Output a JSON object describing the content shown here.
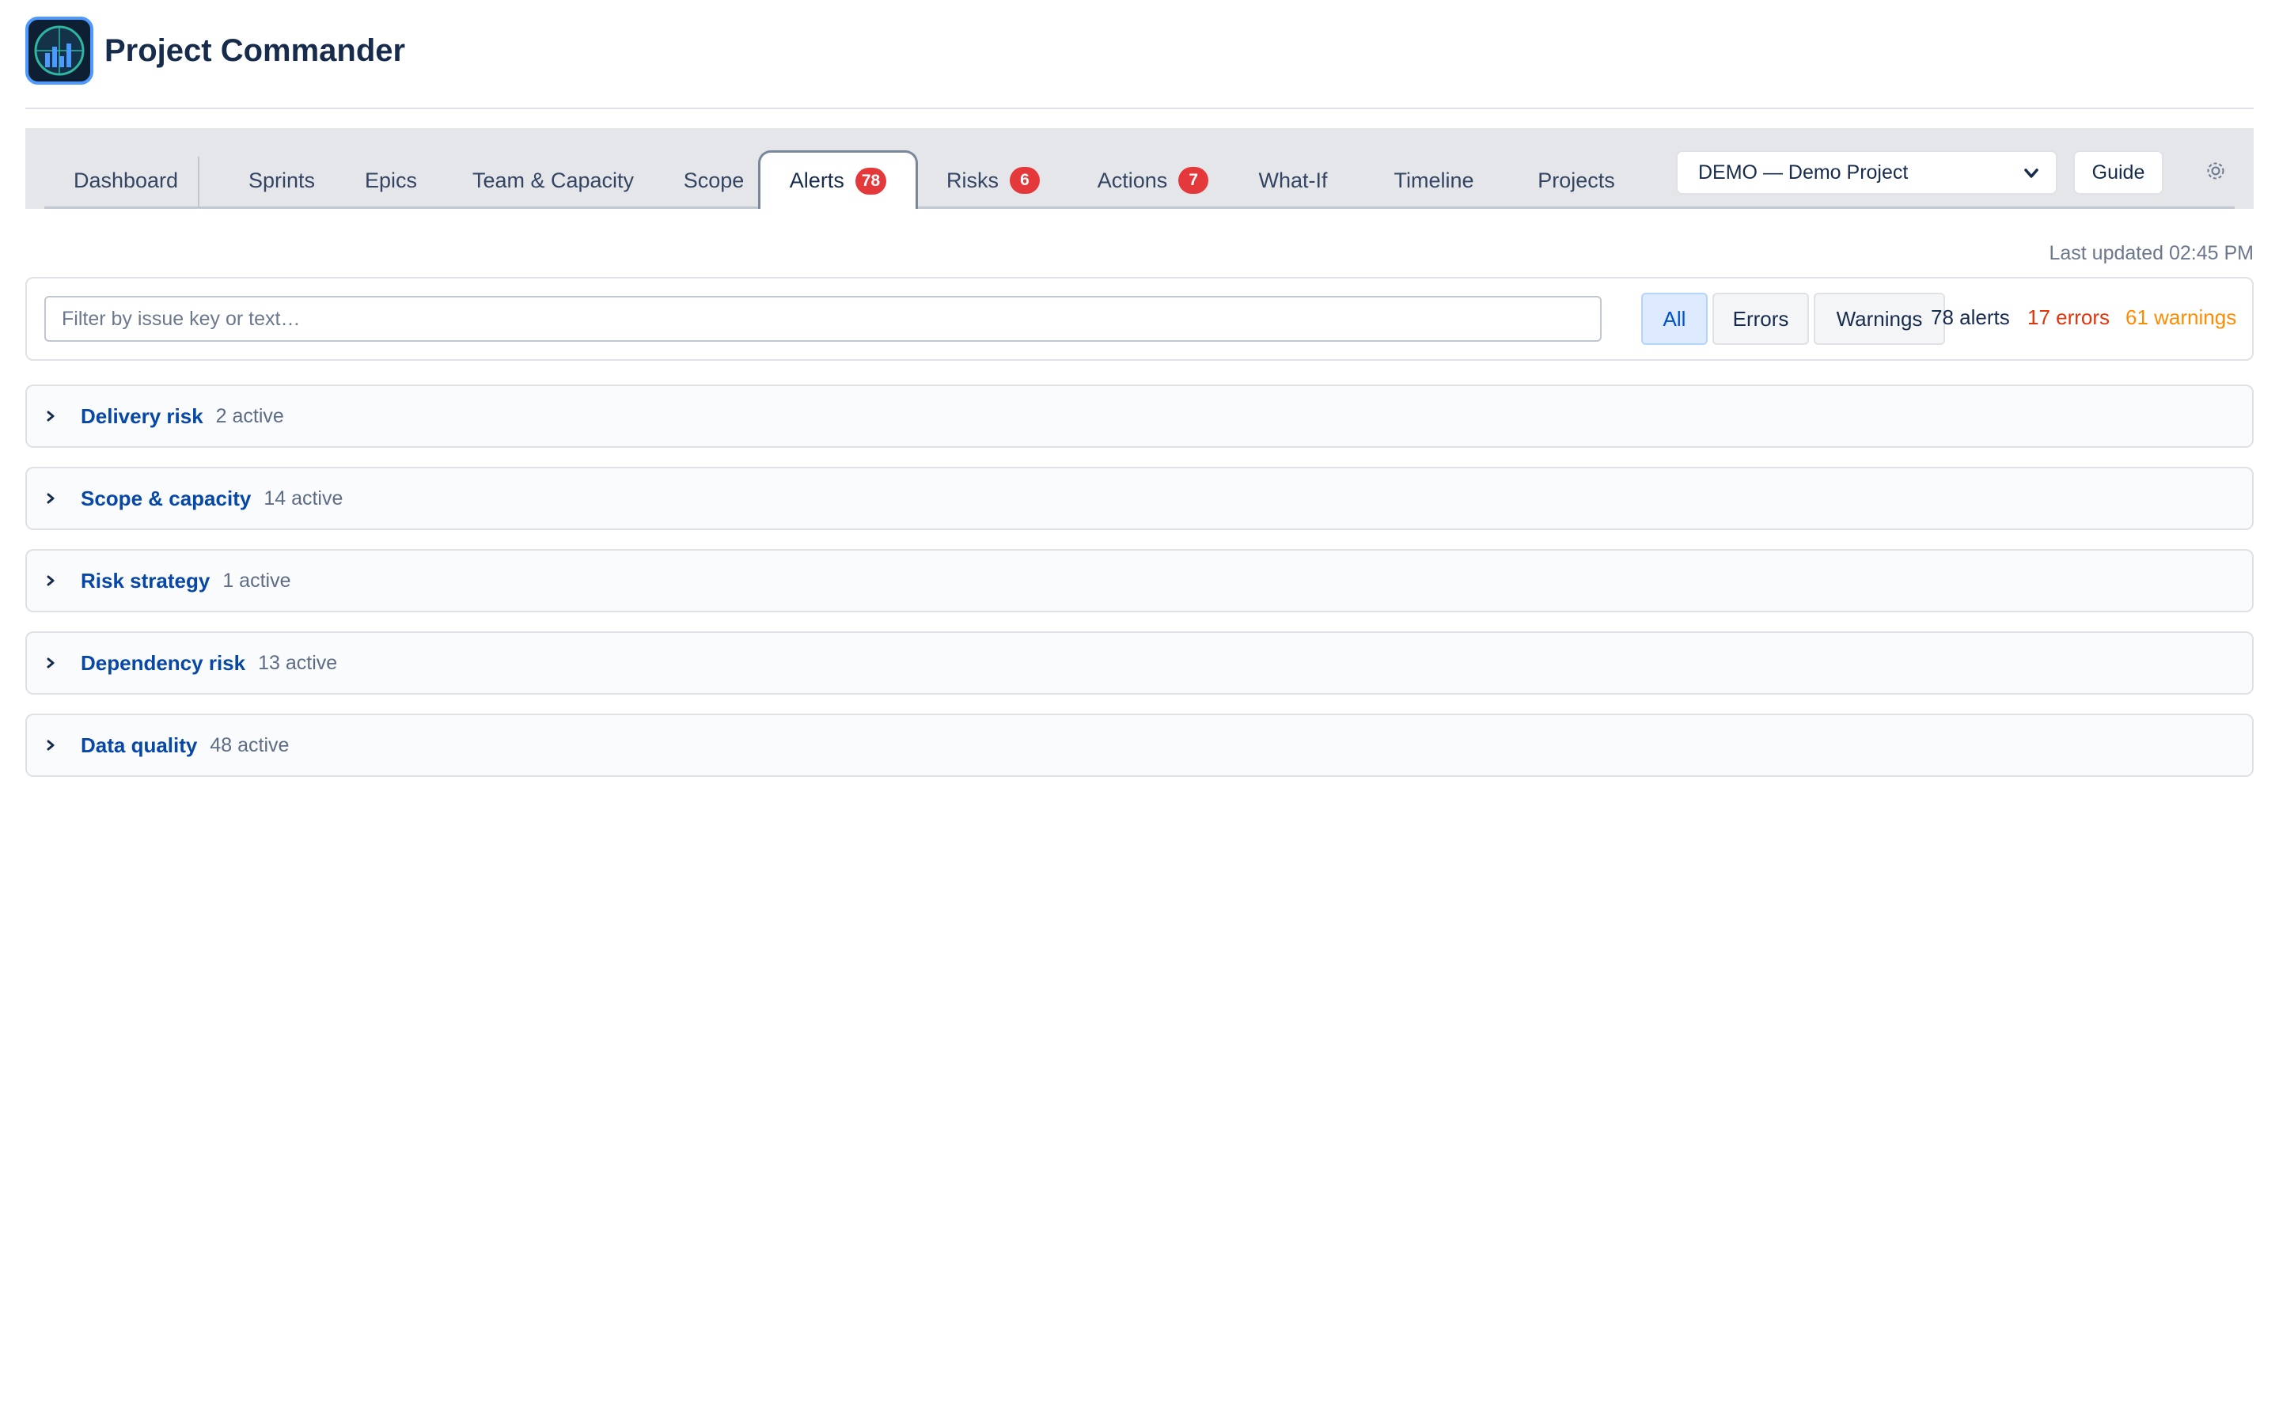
{
  "app": {
    "title": "Project Commander",
    "logo_icon": "radar-chart-icon"
  },
  "tabs": [
    {
      "label": "Dashboard",
      "badge": null,
      "active": false
    },
    {
      "label": "Sprints",
      "badge": null,
      "active": false
    },
    {
      "label": "Epics",
      "badge": null,
      "active": false
    },
    {
      "label": "Team & Capacity",
      "badge": null,
      "active": false
    },
    {
      "label": "Scope",
      "badge": null,
      "active": false
    },
    {
      "label": "Alerts",
      "badge": "78",
      "active": true
    },
    {
      "label": "Risks",
      "badge": "6",
      "active": false
    },
    {
      "label": "Actions",
      "badge": "7",
      "active": false
    },
    {
      "label": "What-If",
      "badge": null,
      "active": false
    },
    {
      "label": "Timeline",
      "badge": null,
      "active": false
    },
    {
      "label": "Projects",
      "badge": null,
      "active": false
    }
  ],
  "project_select": {
    "value": "DEMO — Demo Project"
  },
  "guide_label": "Guide",
  "settings_icon": "gear-icon",
  "last_updated": "Last updated 02:45 PM",
  "filter": {
    "placeholder": "Filter by issue key or text…",
    "value": "",
    "buttons": {
      "all": "All",
      "errors": "Errors",
      "warnings": "Warnings"
    },
    "active": "All",
    "counts": {
      "total": "78 alerts",
      "errors": "17 errors",
      "warnings": "61 warnings"
    }
  },
  "groups": [
    {
      "name": "Delivery risk",
      "count": "2 active"
    },
    {
      "name": "Scope & capacity",
      "count": "14 active"
    },
    {
      "name": "Risk strategy",
      "count": "1 active"
    },
    {
      "name": "Dependency risk",
      "count": "13 active"
    },
    {
      "name": "Data quality",
      "count": "48 active"
    }
  ],
  "colors": {
    "brand": "#0052cc",
    "error": "#de350b",
    "warning": "#ff8b00",
    "badge": "#e5383b"
  }
}
